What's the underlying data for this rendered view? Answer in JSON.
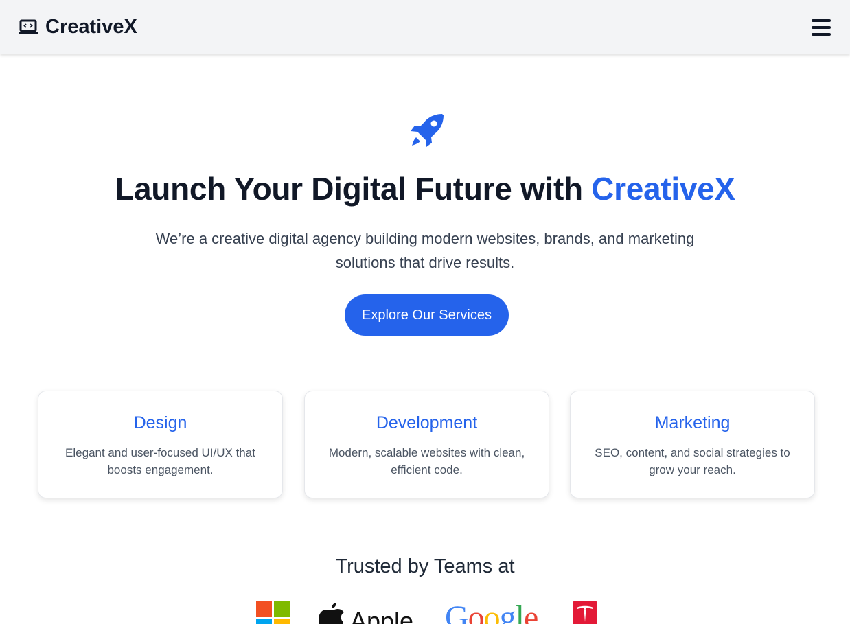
{
  "header": {
    "brand_name": "CreativeX",
    "brand_icon": "laptop-code-icon",
    "menu_icon": "hamburger-menu-icon"
  },
  "hero": {
    "icon": "rocket-icon",
    "title_main": "Launch Your Digital Future with ",
    "title_accent": "CreativeX",
    "subtitle": "We’re a creative digital agency building modern websites, brands, and marketing solutions that drive results.",
    "cta_label": "Explore Our Services"
  },
  "services": [
    {
      "title": "Design",
      "description": "Elegant and user-focused UI/UX that boosts engagement."
    },
    {
      "title": "Development",
      "description": "Modern, scalable websites with clean, efficient code."
    },
    {
      "title": "Marketing",
      "description": "SEO, content, and social strategies to grow your reach."
    }
  ],
  "trusted": {
    "title": "Trusted by Teams at",
    "logos": [
      {
        "name": "Microsoft",
        "icon": "microsoft-logo"
      },
      {
        "name": "Apple",
        "icon": "apple-logo",
        "wordmark": "Apple"
      },
      {
        "name": "Google",
        "icon": "google-logo",
        "wordmark": "Google"
      },
      {
        "name": "Tesla",
        "icon": "tesla-logo"
      }
    ]
  },
  "colors": {
    "accent": "#2563eb",
    "header_bg": "#f3f4f6",
    "text_dark": "#111827",
    "text_muted": "#4b5563"
  }
}
